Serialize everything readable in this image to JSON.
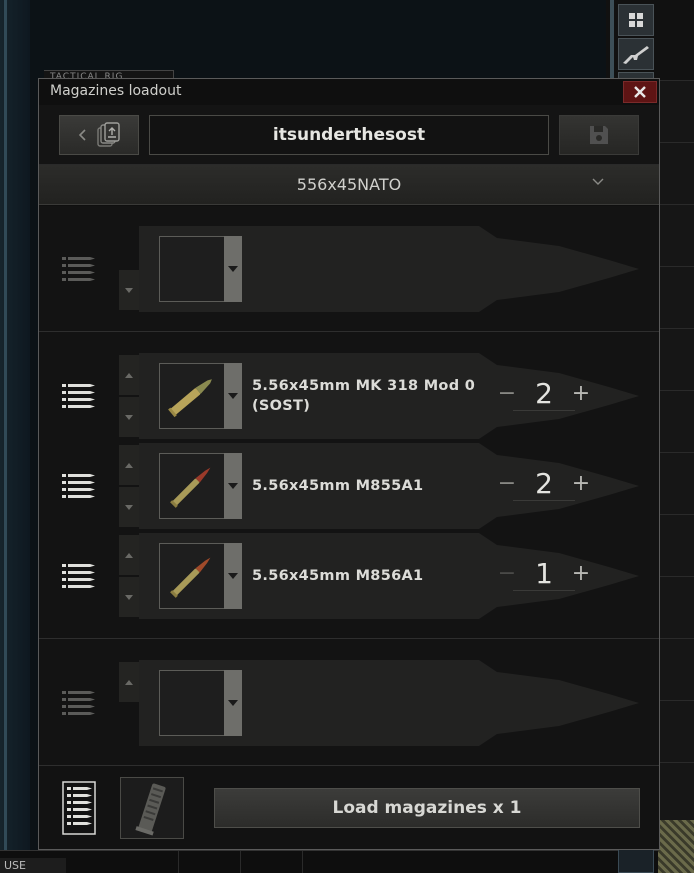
{
  "background": {
    "tab_label": "TACTICAL RIG",
    "bottom_label": "USE"
  },
  "dialog": {
    "title": "Magazines loadout",
    "close_icon": "close-icon",
    "preset_name": "itsunderthesost",
    "caliber": "556x45NATO",
    "sections": [
      {
        "rows": [
          {
            "ammo": "",
            "quantity": "",
            "empty": true
          }
        ]
      },
      {
        "rows": [
          {
            "ammo": "5.56x45mm MK 318 Mod 0 (SOST)",
            "quantity": "2",
            "tip_color": "#8a8a50"
          },
          {
            "ammo": "5.56x45mm M855A1",
            "quantity": "2",
            "tip_color": "#9a3a2a"
          },
          {
            "ammo": "5.56x45mm M856A1",
            "quantity": "1",
            "tip_color": "#a04a2a"
          }
        ]
      },
      {
        "rows": [
          {
            "ammo": "",
            "quantity": "",
            "empty": true
          }
        ]
      }
    ],
    "qty_minus": "−",
    "qty_plus": "+",
    "load_button": "Load magazines x 1"
  },
  "colors": {
    "close": "#5e1414",
    "panel": "#131313",
    "bullet": "#222221",
    "text": "#dcdcd8"
  }
}
